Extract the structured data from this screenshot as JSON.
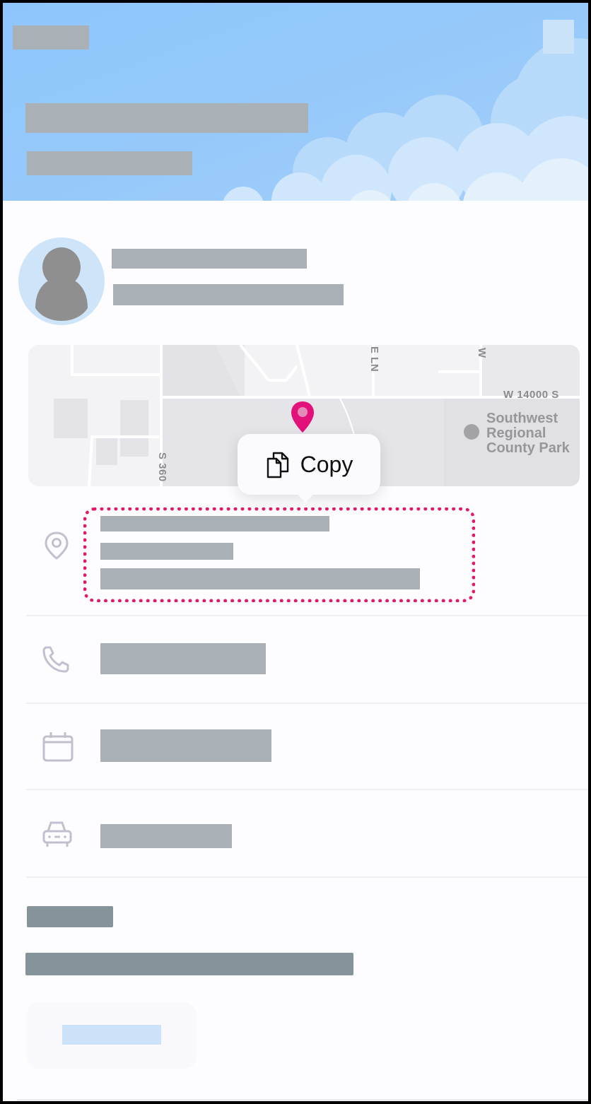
{
  "header": {
    "title_redacted": true,
    "subtitle_redacted": true,
    "top_label_redacted": true,
    "close_button": "close"
  },
  "profile": {
    "avatar_icon": "person-icon",
    "name_redacted": true,
    "secondary_redacted": true
  },
  "map": {
    "labels": {
      "street_1": "S 360",
      "street_2": "E LN",
      "street_3": "W",
      "street_4": "W 14000 S",
      "park_line1": "Southwest",
      "park_line2": "Regional",
      "park_line3": "County Park"
    },
    "pin_color": "#e2127a"
  },
  "popover": {
    "icon": "copy-icon",
    "label": "Copy"
  },
  "details": {
    "address": {
      "icon": "location-pin-icon",
      "lines_redacted": 3,
      "highlight_color": "#e2186b"
    },
    "phone": {
      "icon": "phone-icon"
    },
    "date": {
      "icon": "calendar-icon"
    },
    "vehicle": {
      "icon": "car-icon"
    }
  },
  "section": {
    "heading_redacted": true,
    "body_redacted": true,
    "action_button_redacted": true
  },
  "colors": {
    "accent": "#e2186b",
    "header_sky": "#8ec6fc",
    "redaction": "#a9b0b6",
    "icon_muted": "#c4bfce"
  }
}
